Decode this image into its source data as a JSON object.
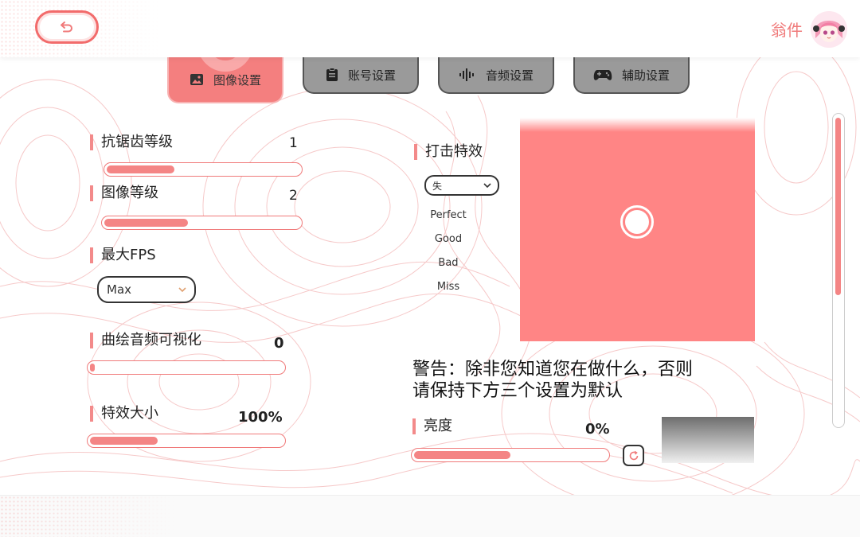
{
  "header": {
    "user_name": "翁件",
    "back_icon": "back-arrow-icon",
    "avatar_icon": "avatar-icon"
  },
  "tabs": [
    {
      "label": "图像设置",
      "icon": "image-icon",
      "active": true
    },
    {
      "label": "账号设置",
      "icon": "clipboard-icon",
      "active": false
    },
    {
      "label": "音频设置",
      "icon": "audio-wave-icon",
      "active": false
    },
    {
      "label": "辅助设置",
      "icon": "gamepad-icon",
      "active": false
    }
  ],
  "settings": {
    "antialias": {
      "label": "抗锯齿等级",
      "value": "1",
      "fill_fraction": 0.35
    },
    "image_quality": {
      "label": "图像等级",
      "value": "2",
      "fill_fraction": 0.43
    },
    "max_fps": {
      "label": "最大FPS",
      "selected": "Max"
    },
    "curve_visual": {
      "label": "曲绘音频可视化",
      "value": "0",
      "fill_fraction": 0.02
    },
    "effect_size": {
      "label": "特效大小",
      "value": "100%",
      "fill_fraction": 0.35
    },
    "hit_effect": {
      "label": "打击特效",
      "selected": "失",
      "options": [
        "Perfect",
        "Good",
        "Bad",
        "Miss"
      ]
    },
    "brightness": {
      "label": "亮度",
      "value": "0%",
      "fill_fraction": 0.5
    }
  },
  "warning": {
    "line1": "警告：除非您知道您在做什么，否则",
    "line2": "请保持下方三个设置为默认"
  },
  "colors": {
    "accent": "#f48585",
    "accent_border": "#f07a7a",
    "tab_inactive": "#9a9a9a",
    "preview_bg": "#ff8585"
  },
  "scrollbar": {
    "thumb_fraction": 0.58
  }
}
